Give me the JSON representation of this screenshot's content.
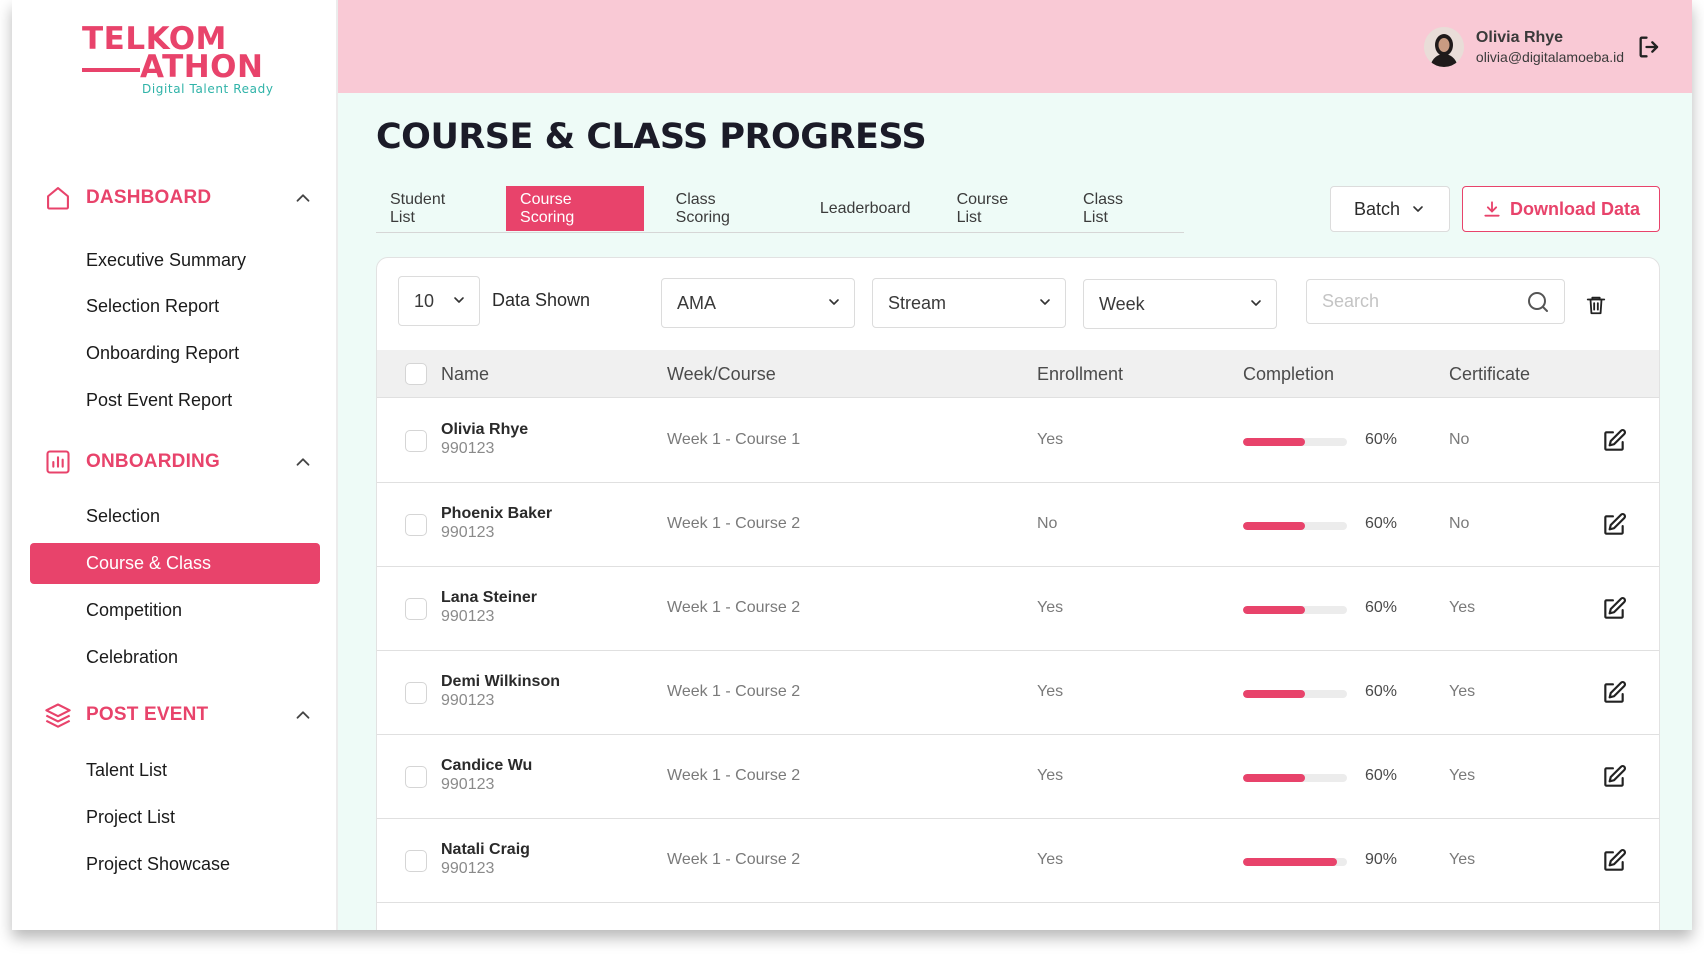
{
  "brand": {
    "line1": "TELKOM",
    "line2": "ATHON",
    "tagline": "Digital Talent Ready",
    "accent": "#e8436b",
    "secondary": "#2fb3a8"
  },
  "sidebar": {
    "sections": [
      {
        "label": "DASHBOARD",
        "icon": "home-icon",
        "items": [
          "Executive Summary",
          "Selection Report",
          "Onboarding Report",
          "Post Event Report"
        ]
      },
      {
        "label": "ONBOARDING",
        "icon": "bar-chart-icon",
        "items": [
          "Selection",
          "Course & Class",
          "Competition",
          "Celebration"
        ]
      },
      {
        "label": "POST EVENT",
        "icon": "layers-icon",
        "items": [
          "Talent List",
          "Project List",
          "Project Showcase"
        ]
      }
    ],
    "active_item": "Course & Class"
  },
  "user": {
    "name": "Olivia Rhye",
    "email": "olivia@digitalamoeba.id"
  },
  "page": {
    "title": "COURSE & CLASS PROGRESS"
  },
  "tabs": [
    {
      "label": "Student List",
      "active": false
    },
    {
      "label": "Course Scoring",
      "active": true
    },
    {
      "label": "Class Scoring",
      "active": false
    },
    {
      "label": "Leaderboard",
      "active": false
    },
    {
      "label": "Course List",
      "active": false
    },
    {
      "label": "Class List",
      "active": false
    }
  ],
  "actions": {
    "batch_label": "Batch",
    "download_label": "Download Data"
  },
  "filters": {
    "page_size": "10",
    "page_size_label": "Data Shown",
    "program": "AMA",
    "stream": "Stream",
    "week": "Week",
    "search_placeholder": "Search"
  },
  "table": {
    "columns": [
      "Name",
      "Week/Course",
      "Enrollment",
      "Completion",
      "Certificate"
    ],
    "rows": [
      {
        "name": "Olivia Rhye",
        "id": "990123",
        "week_course": "Week 1 - Course 1",
        "enrollment": "Yes",
        "completion": 60,
        "completion_label": "60%",
        "certificate": "No"
      },
      {
        "name": "Phoenix Baker",
        "id": "990123",
        "week_course": "Week 1 - Course 2",
        "enrollment": "No",
        "completion": 60,
        "completion_label": "60%",
        "certificate": "No"
      },
      {
        "name": "Lana Steiner",
        "id": "990123",
        "week_course": "Week 1 - Course 2",
        "enrollment": "Yes",
        "completion": 60,
        "completion_label": "60%",
        "certificate": "Yes"
      },
      {
        "name": "Demi Wilkinson",
        "id": "990123",
        "week_course": "Week 1 - Course 2",
        "enrollment": "Yes",
        "completion": 60,
        "completion_label": "60%",
        "certificate": "Yes"
      },
      {
        "name": "Candice Wu",
        "id": "990123",
        "week_course": "Week 1 - Course 2",
        "enrollment": "Yes",
        "completion": 60,
        "completion_label": "60%",
        "certificate": "Yes"
      },
      {
        "name": "Natali Craig",
        "id": "990123",
        "week_course": "Week 1 - Course 2",
        "enrollment": "Yes",
        "completion": 90,
        "completion_label": "90%",
        "certificate": "Yes"
      }
    ]
  }
}
